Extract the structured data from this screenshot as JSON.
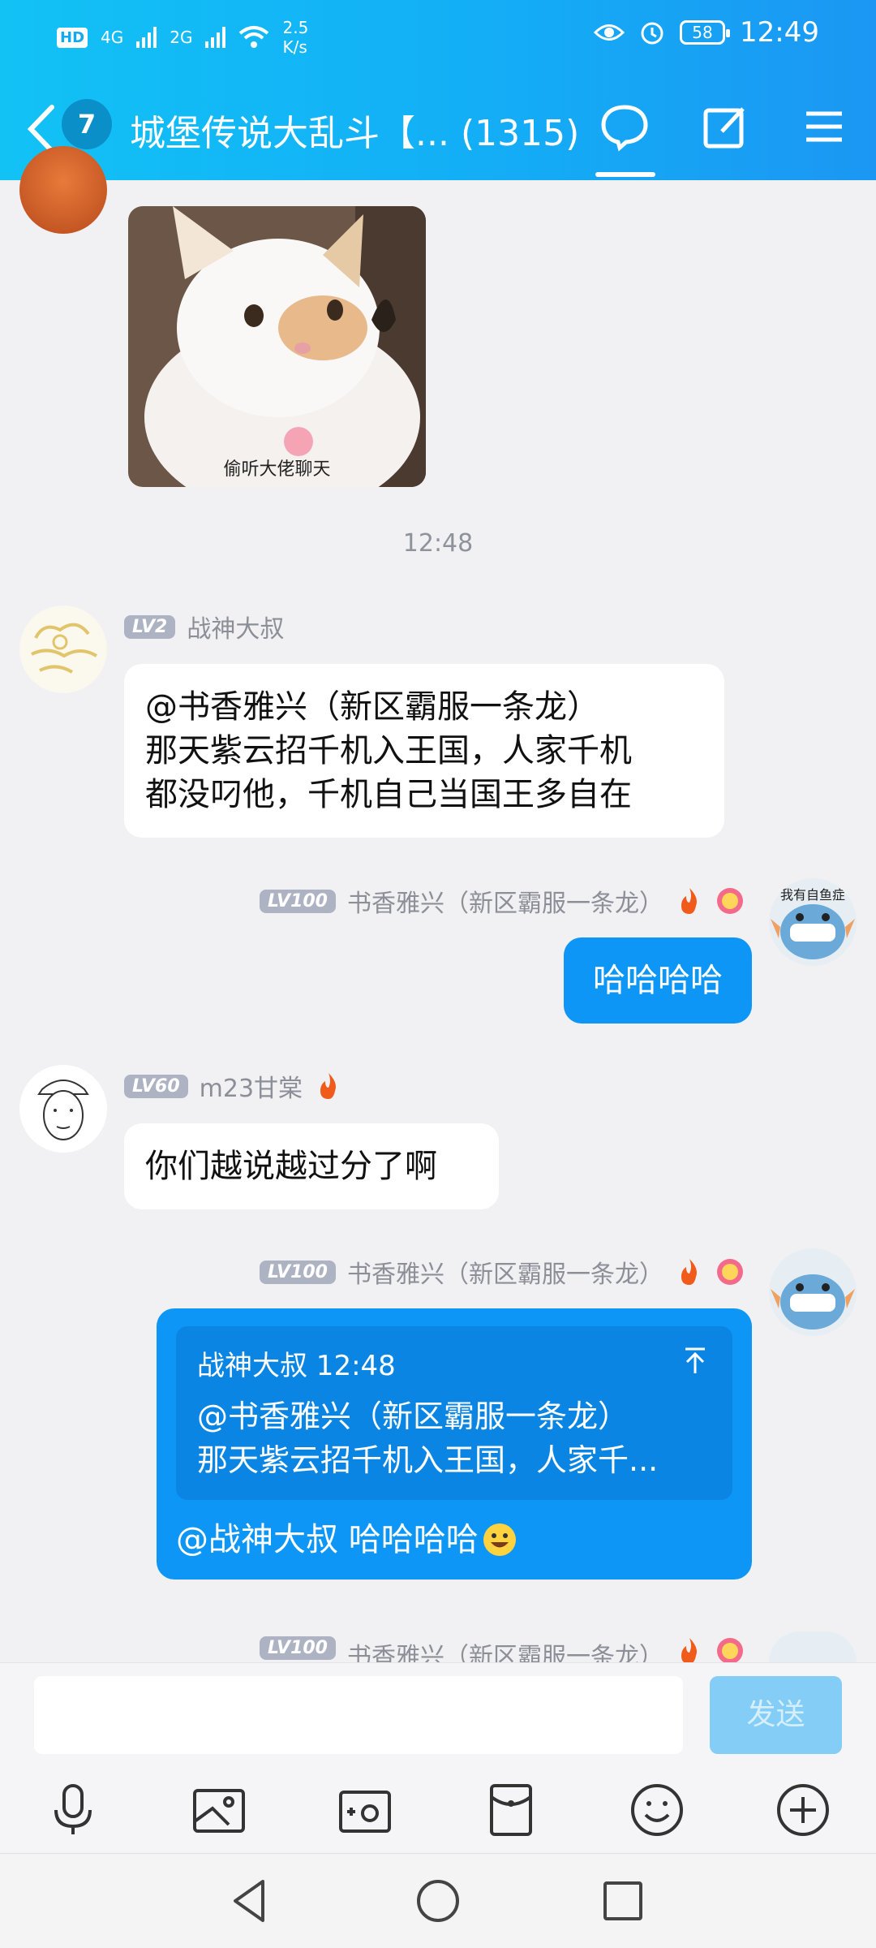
{
  "status_bar": {
    "hd": "HD",
    "net_g1": "4G",
    "net_g2": "2G",
    "speed_value": "2.5",
    "speed_unit": "K/s",
    "battery": "58",
    "time": "12:49"
  },
  "header": {
    "unread_count": "7",
    "title": "城堡传说大乱斗【... (1315)"
  },
  "cat_image": {
    "caption": "偷听大佬聊天"
  },
  "timestamp": "12:48",
  "messages": [
    {
      "level": "LV2",
      "name": "战神大叔",
      "lines": [
        "@书香雅兴（新区霸服一条龙）",
        "那天紫云招千机入王国，人家千机",
        "都没叼他，千机自己当国王多自在"
      ]
    },
    {
      "level": "LV100",
      "name": "书香雅兴（新区霸服一条龙）",
      "text": "哈哈哈哈"
    },
    {
      "level": "LV60",
      "name": "m23甘棠",
      "text": "你们越说越过分了啊"
    },
    {
      "level": "LV100",
      "name": "书香雅兴（新区霸服一条龙）",
      "quote": {
        "author_time": "战神大叔 12:48",
        "lines": [
          "@书香雅兴（新区霸服一条龙）",
          "那天紫云招千机入王国，人家千..."
        ]
      },
      "text": "@战神大叔 哈哈哈哈"
    },
    {
      "level": "LV100",
      "name": "书香雅兴（新区霸服一条龙）"
    }
  ],
  "avatar_text": "我有自鱼症",
  "input": {
    "placeholder": "",
    "send_label": "发送"
  },
  "colors": {
    "header_start": "#12c2f5",
    "header_end": "#1b97f3",
    "my_bubble": "#0d96f5",
    "level_badge": "#aeb3c4"
  }
}
